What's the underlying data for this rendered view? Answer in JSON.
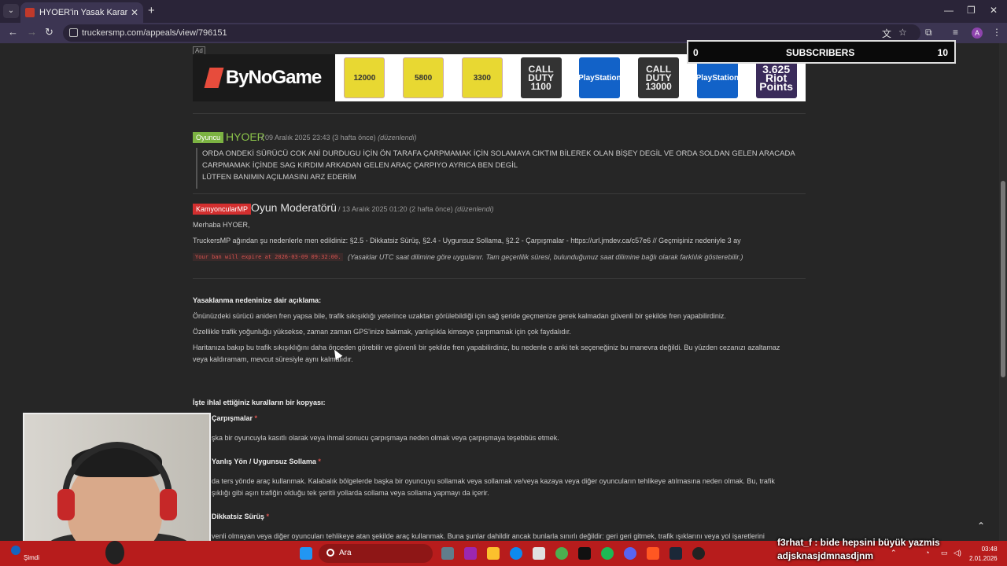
{
  "browser": {
    "tab_title": "HYOER'in Yasak Kararına İtiraz",
    "url": "truckersmp.com/appeals/view/796151"
  },
  "ad": {
    "badge": "Ad",
    "logo": "ByNoGame",
    "products": [
      "12000",
      "5800",
      "3300",
      "CALL DUTY 1100",
      "PlayStation",
      "CALL DUTY 13000",
      "PlayStation",
      "3.625 Riot Points"
    ]
  },
  "overlay": {
    "sub_count": "0",
    "sub_label": "SUBSCRIBERS",
    "sub_goal": "10",
    "chat_line1": "f3rhat_f : bide hepsini büyük yazmis",
    "chat_line2": "adjsknasjdmnasdjnm"
  },
  "comment1": {
    "badge": "Oyuncu",
    "author": "HYOER",
    "meta": "/ 09 Aralık 2025 23:43 (3 hafta önce)",
    "edited": "(düzenlendi)",
    "lines": [
      "ORDA ONDEKİ SÜRÜCÜ COK ANİ DURDUGU İÇİN ÖN TARAFA ÇARPMAMAK İÇİN SOLAMAYA CIKTIM BİLEREK OLAN BİŞEY DEGİL VE ORDA SOLDAN GELEN ARACADA",
      "CARPMAMAK İÇİNDE SAG KIRDIM ARKADAN GELEN ARAÇ ÇARPIYO AYRICA BEN DEGİL",
      "LÜTFEN BANIMIN AÇILMASINI ARZ EDERİM"
    ]
  },
  "comment2": {
    "badge": "KamyoncularMP",
    "author": "Oyun Moderatörü",
    "meta": "/ 13 Aralık 2025 01:20 (2 hafta önce)",
    "edited": "(düzenlendi)",
    "greeting": "Merhaba HYOER,",
    "ban_line": "TruckersMP ağından şu nedenlerle men edildiniz: §2.5 - Dikkatsiz Sürüş, §2.4 - Uygunsuz Sollama, §2.2 - Çarpışmalar - https://url.jmdev.ca/c57e6 // Geçmişiniz nedeniyle 3 ay",
    "expiry_code": "Your ban will expire at 2026-03-09 09:32:00.",
    "expiry_note": "(Yasaklar UTC saat dilimine göre uygulanır. Tam geçerlilik süresi, bulunduğunuz saat dilimine bağlı olarak farklılık gösterebilir.)",
    "reasons_title": "Yasaklanma nedeninize dair açıklama:",
    "reason1": "Önünüzdeki sürücü aniden fren yapsa bile, trafik sıkışıklığı yeterince uzaktan görülebildiği için sağ şeride geçmenize gerek kalmadan güvenli bir şekilde fren yapabilirdiniz.",
    "reason2": "Özellikle trafik yoğunluğu yüksekse, zaman zaman GPS'inize bakmak, yanlışlıkla kimseye çarpmamak için çok faydalıdır.",
    "reason3": "Haritanıza bakıp bu trafik sıkışıklığını daha önceden görebilir ve güvenli bir şekilde fren yapabilirdiniz, bu nedenle o anki tek seçeneğiniz bu manevra değildi. Bu yüzden cezanızı azaltamaz veya kaldıramam, mevcut süresiyle aynı kalmalıdır.",
    "rules_title": "İşte ihlal ettiğiniz kuralların bir kopyası:",
    "rule1_title": "Çarpışmalar",
    "rule1_text": "şka bir oyuncuyla kasıtlı olarak veya ihmal sonucu çarpışmaya neden olmak veya çarpışmaya teşebbüs etmek.",
    "rule2_title": "Yanlış Yön / Uygunsuz Sollama",
    "rule2_text_a": "da ters yönde araç kullanmak. Kalabalık bölgelerde başka bir oyuncuyu sollamak veya sollamak ve/veya kazaya veya diğer oyuncuların tehlikeye atılmasına neden olmak. Bu, trafik",
    "rule2_text_b": "şıklığı gibi aşırı trafiğin olduğu tek şeritli yollarda sollama veya sollama yapmayı da içerir.",
    "rule3_title": "Dikkatsiz Sürüş",
    "rule3_text": "venli olmayan veya diğer oyuncuları tehlikeye atan şekilde araç kullanmak. Buna şunlar dahildir ancak bunlarla sınırlı değildir: geri geri gitmek, trafik ışıklarını veya yol işaretlerini"
  },
  "taskbar": {
    "weather": "Şimdi",
    "search": "Ara",
    "time": "03:48",
    "date": "2.01.2026"
  }
}
